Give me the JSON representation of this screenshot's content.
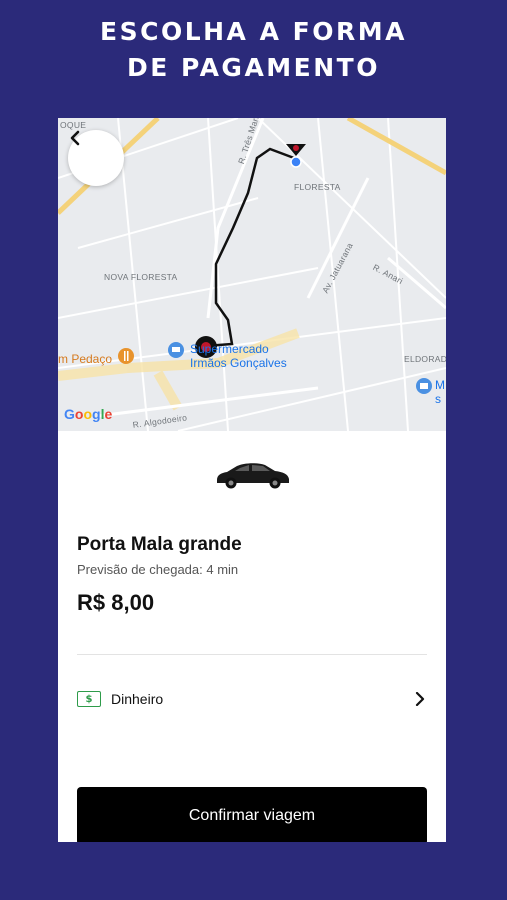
{
  "headline": {
    "line1": "ESCOLHA A FORMA",
    "line2": "DE PAGAMENTO"
  },
  "map": {
    "labels": {
      "oque": "OQUE",
      "floresta": "FLORESTA",
      "nova_floresta": "NOVA FLORESTA",
      "tres_marias": "R. Três Marias",
      "av_jatuarana": "Av. Jatuarana",
      "r_anari": "R. Anari",
      "eldorado": "ELDORAD",
      "r_algodoeiro": "R. Algodoeiro",
      "pedaco": "m Pedaço",
      "supermercado_l1": "Supermercado",
      "supermercado_l2": "Irmãos Gonçalves",
      "shop_l1": "M",
      "shop_l2": "s"
    },
    "google": [
      "G",
      "o",
      "o",
      "g",
      "l",
      "e"
    ],
    "colors": {
      "route": "#111111",
      "origin_pin": "#c0172c",
      "destination_dot": "#3b82f6",
      "main_road": "#f4d27a",
      "poi_text": "#1a73e8",
      "food_text": "#d67a1e"
    }
  },
  "ride": {
    "vehicle_name": "Porta Mala grande",
    "eta": "Previsão de chegada: 4 min",
    "price": "R$ 8,00"
  },
  "payment": {
    "method": "Dinheiro",
    "icon": "cash-icon",
    "icon_symbol": "$"
  },
  "actions": {
    "confirm": "Confirmar viagem"
  }
}
